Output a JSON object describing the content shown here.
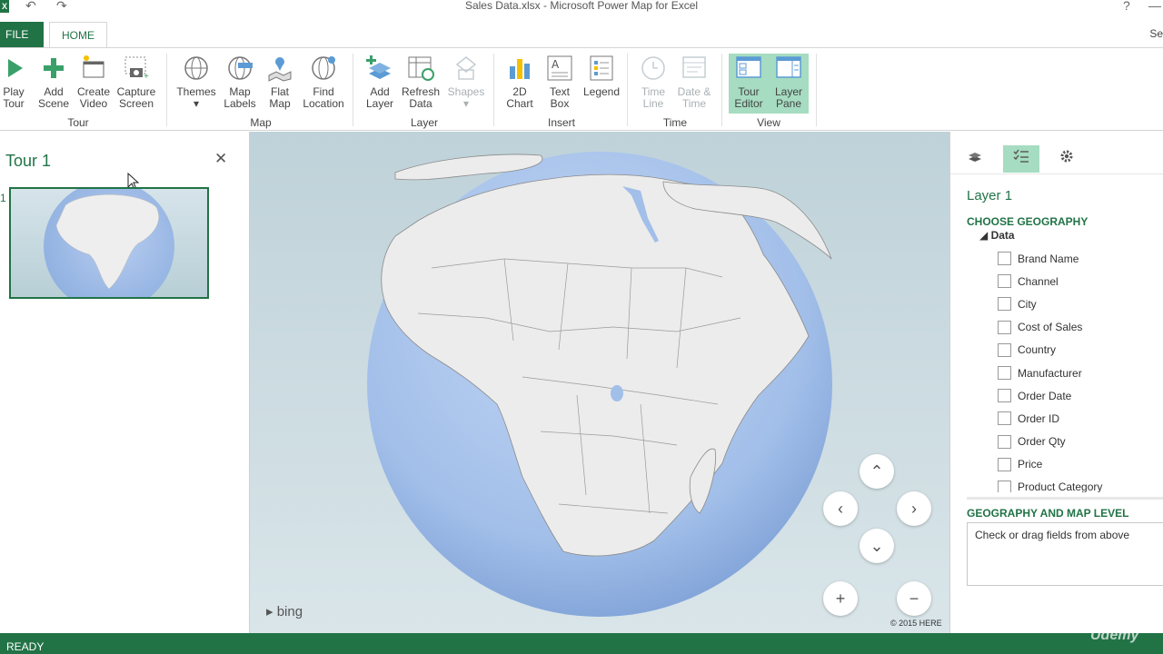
{
  "window": {
    "title": "Sales Data.xlsx - Microsoft Power Map for Excel",
    "help": "?",
    "minimize": "—"
  },
  "quick_access": {
    "app_badge": "X",
    "undo": "↶",
    "redo": "↷"
  },
  "tabs": {
    "file": "FILE",
    "home": "HOME",
    "search": "Se"
  },
  "ribbon": {
    "tour": {
      "group": "Tour",
      "play_tour": [
        "Play",
        "Tour"
      ],
      "add_scene": [
        "Add",
        "Scene"
      ],
      "create_video": [
        "Create",
        "Video"
      ],
      "capture_screen": [
        "Capture",
        "Screen"
      ]
    },
    "map": {
      "group": "Map",
      "themes": "Themes",
      "map_labels": [
        "Map",
        "Labels"
      ],
      "flat_map": [
        "Flat",
        "Map"
      ],
      "find_location": [
        "Find",
        "Location"
      ]
    },
    "layer": {
      "group": "Layer",
      "add_layer": [
        "Add",
        "Layer"
      ],
      "refresh_data": [
        "Refresh",
        "Data"
      ],
      "shapes": "Shapes"
    },
    "insert": {
      "group": "Insert",
      "chart_2d": [
        "2D",
        "Chart"
      ],
      "text_box": [
        "Text",
        "Box"
      ],
      "legend": "Legend"
    },
    "time": {
      "group": "Time",
      "time_line": [
        "Time",
        "Line"
      ],
      "date_time": [
        "Date &",
        "Time"
      ]
    },
    "view": {
      "group": "View",
      "tour_editor": [
        "Tour",
        "Editor"
      ],
      "layer_pane": [
        "Layer",
        "Pane"
      ]
    }
  },
  "tour_pane": {
    "title": "Tour 1",
    "close": "✕",
    "scene_number": "1"
  },
  "map": {
    "attribution": "bing",
    "copyright": "© 2015 HERE",
    "nav": {
      "up": "⌃",
      "left": "‹",
      "right": "›",
      "down": "⌄",
      "zoom_in": "+",
      "zoom_out": "−"
    }
  },
  "layer_pane": {
    "layer_name": "Layer 1",
    "choose_geography": "CHOOSE GEOGRAPHY",
    "tree_root": "Data",
    "fields": [
      "Brand Name",
      "Channel",
      "City",
      "Cost of Sales",
      "Country",
      "Manufacturer",
      "Order Date",
      "Order ID",
      "Order Qty",
      "Price",
      "Product Category"
    ],
    "geo_level_header": "GEOGRAPHY AND MAP LEVEL",
    "geo_placeholder": "Check or drag fields from above"
  },
  "status": {
    "text": "READY",
    "watermark": "Udemy"
  },
  "colors": {
    "accent": "#217346",
    "active_button": "#a6dcc1",
    "ocean": "#9fbde8",
    "land": "#eeeeee"
  }
}
